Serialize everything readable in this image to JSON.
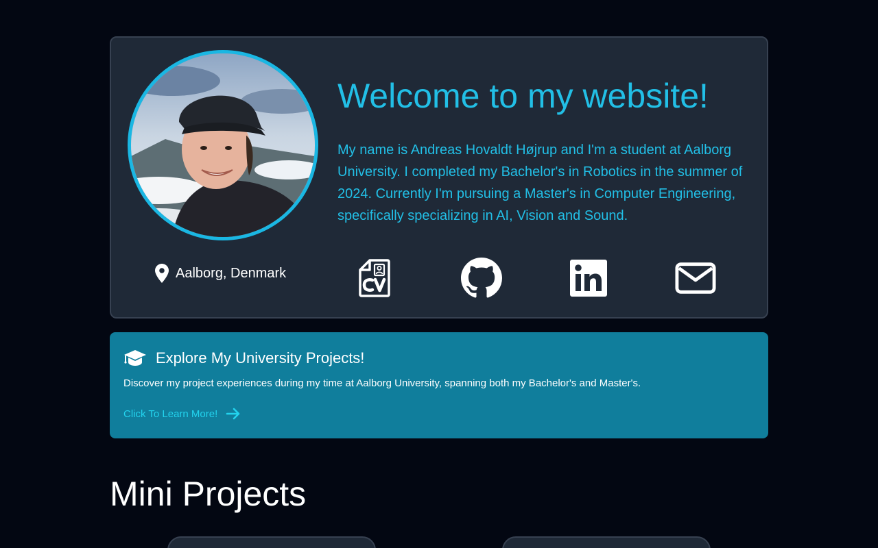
{
  "hero": {
    "title": "Welcome to my website!",
    "bio": "My name is Andreas Hovaldt Højrup and I'm a student at Aalborg University. I completed my Bachelor's in Robotics in the summer of 2024. Currently I'm pursuing a Master's in Computer Engineering, specifically specializing in AI, Vision and Sound.",
    "location": "Aalborg, Denmark"
  },
  "socials": [
    {
      "icon": "cv-file-icon"
    },
    {
      "icon": "github-icon"
    },
    {
      "icon": "linkedin-icon"
    },
    {
      "icon": "envelope-icon"
    }
  ],
  "university": {
    "title": "Explore My University Projects!",
    "description": "Discover my project experiences during my time at Aalborg University, spanning both my Bachelor's and Master's.",
    "link_label": "Click To Learn More!"
  },
  "mini_projects": {
    "title": "Mini Projects"
  },
  "colors": {
    "background": "#030712",
    "card": "#1f2937",
    "accent": "#22bfe6",
    "banner": "#107e9c"
  }
}
